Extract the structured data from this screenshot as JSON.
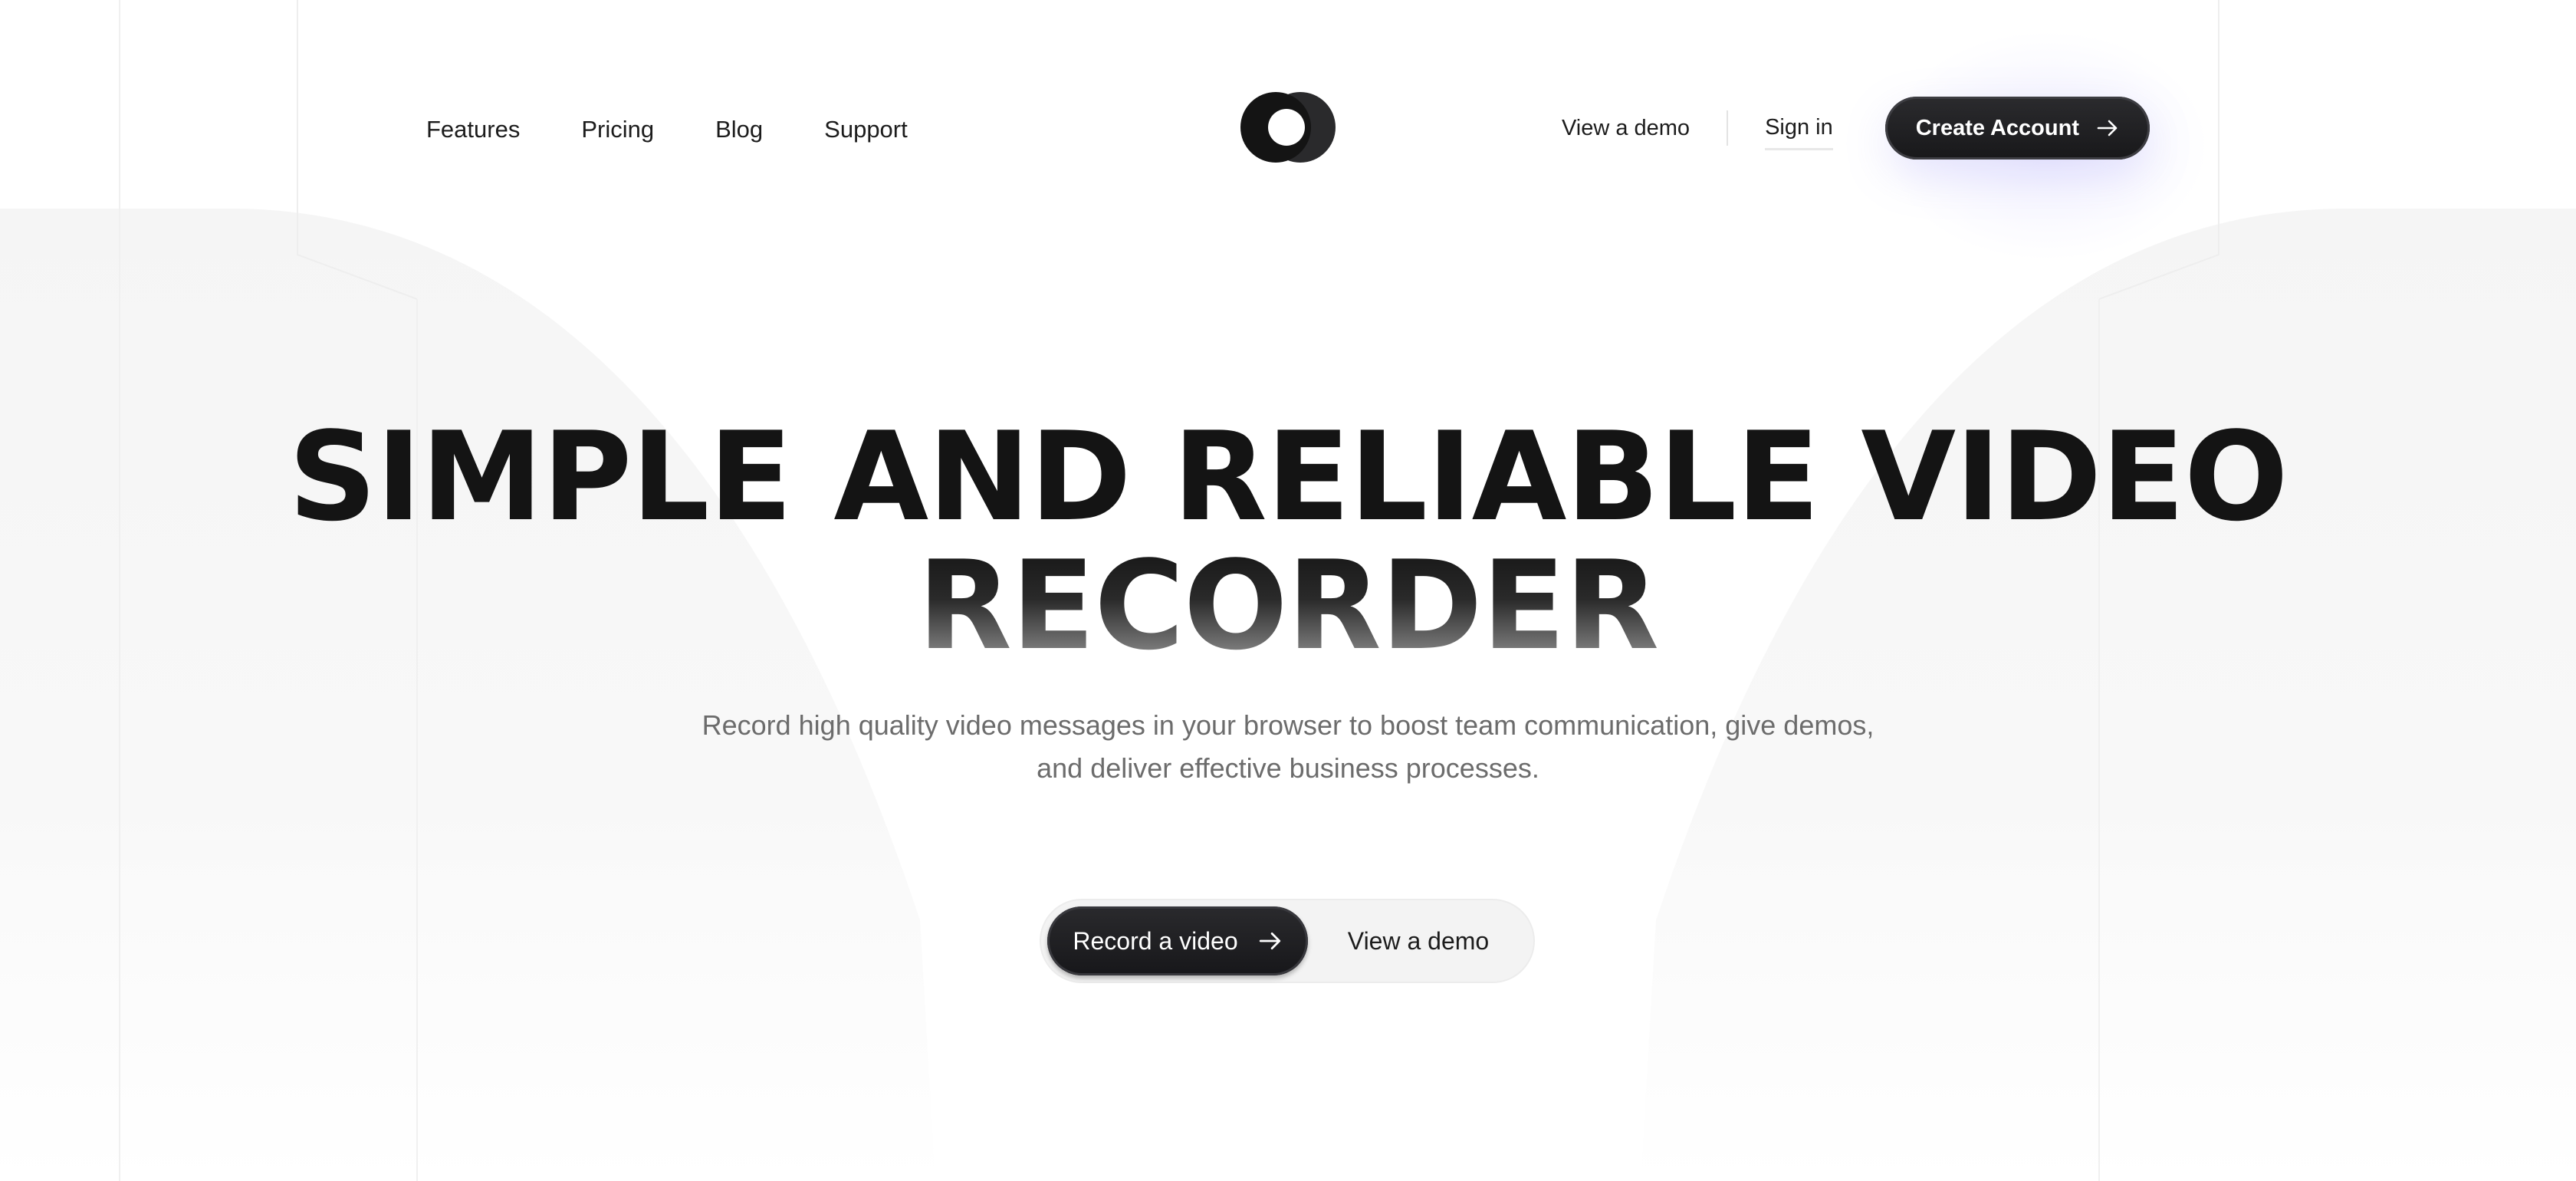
{
  "nav": {
    "links": [
      {
        "label": "Features"
      },
      {
        "label": "Pricing"
      },
      {
        "label": "Blog"
      },
      {
        "label": "Support"
      }
    ],
    "view_demo": "View a demo",
    "sign_in": "Sign in",
    "create_account": "Create Account"
  },
  "logo": {
    "icon": "two-overlapping-circles-logo"
  },
  "hero": {
    "title_line1": "SIMPLE AND RELIABLE VIDEO",
    "title_line2": "RECORDER",
    "subtitle_line1": "Record high quality video messages in your browser to boost team communication, give demos,",
    "subtitle_line2": "and deliver effective business processes."
  },
  "cta": {
    "record_label": "Record a video",
    "demo_label": "View a demo"
  },
  "colors": {
    "primary_dark": "#1a1a1c",
    "text": "#1c1c1c",
    "subtitle": "#6c6c6c",
    "background": "#ffffff"
  },
  "icons": {
    "arrow": "arrow-right-icon"
  }
}
